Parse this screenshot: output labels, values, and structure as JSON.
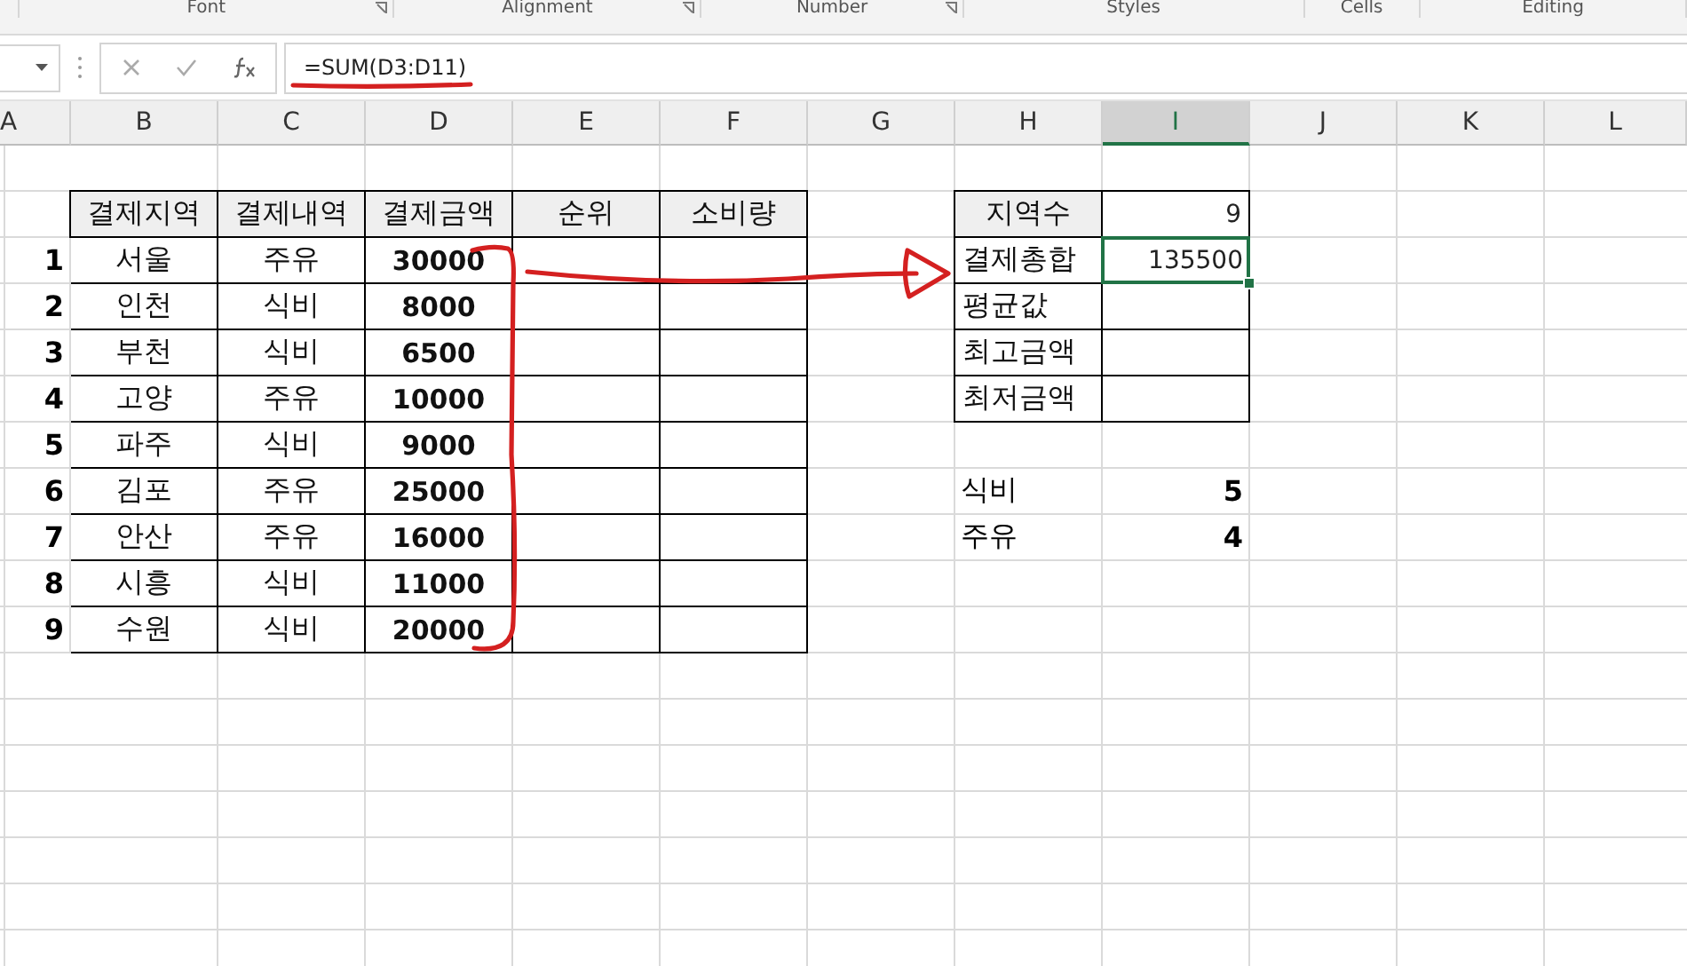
{
  "ribbon_groups": [
    "Font",
    "Alignment",
    "Number",
    "Styles",
    "Cells",
    "Editing"
  ],
  "formula_bar": {
    "formula": "=SUM(D3:D11)"
  },
  "columns": [
    {
      "label": "A",
      "selected": false
    },
    {
      "label": "B",
      "selected": false
    },
    {
      "label": "C",
      "selected": false
    },
    {
      "label": "D",
      "selected": false
    },
    {
      "label": "E",
      "selected": false
    },
    {
      "label": "F",
      "selected": false
    },
    {
      "label": "G",
      "selected": false
    },
    {
      "label": "H",
      "selected": false
    },
    {
      "label": "I",
      "selected": true
    },
    {
      "label": "J",
      "selected": false
    },
    {
      "label": "K",
      "selected": false
    },
    {
      "label": "L",
      "selected": false
    }
  ],
  "payment_table": {
    "headers": [
      "결제지역",
      "결제내역",
      "결제금액",
      "순위",
      "소비량"
    ],
    "rows": [
      {
        "number": "1",
        "region": "서울",
        "item": "주유",
        "amount": "30000"
      },
      {
        "number": "2",
        "region": "인천",
        "item": "식비",
        "amount": "8000"
      },
      {
        "number": "3",
        "region": "부천",
        "item": "식비",
        "amount": "6500"
      },
      {
        "number": "4",
        "region": "고양",
        "item": "주유",
        "amount": "10000"
      },
      {
        "number": "5",
        "region": "파주",
        "item": "식비",
        "amount": "9000"
      },
      {
        "number": "6",
        "region": "김포",
        "item": "주유",
        "amount": "25000"
      },
      {
        "number": "7",
        "region": "안산",
        "item": "주유",
        "amount": "16000"
      },
      {
        "number": "8",
        "region": "시흥",
        "item": "식비",
        "amount": "11000"
      },
      {
        "number": "9",
        "region": "수원",
        "item": "식비",
        "amount": "20000"
      }
    ]
  },
  "summary_table": {
    "rows": [
      {
        "label": "지역수",
        "value": "9",
        "shaded": true,
        "selected": false
      },
      {
        "label": "결제총합",
        "value": "135500",
        "shaded": false,
        "selected": true
      },
      {
        "label": "평균값",
        "shaded": false,
        "selected": false
      },
      {
        "label": "최고금액",
        "shaded": false,
        "selected": false
      },
      {
        "label": "최저금액",
        "shaded": false,
        "selected": false
      }
    ]
  },
  "category_counts": [
    {
      "label": "식비",
      "value": "5"
    },
    {
      "label": "주유",
      "value": "4"
    }
  ]
}
